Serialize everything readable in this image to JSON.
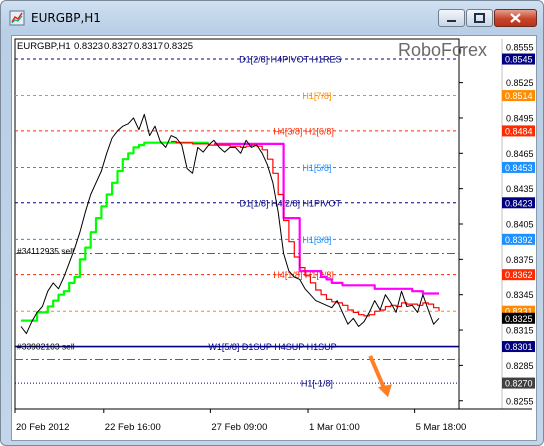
{
  "window": {
    "title": "EURGBP,H1"
  },
  "chart_info": {
    "symbol": "EURGBP,H1",
    "open": "0.8323",
    "high": "0.8327",
    "low": "0.8317",
    "close": "0.8325"
  },
  "watermark": "RoboForex",
  "colors": {
    "price": "#000000",
    "ma_fast": "#ff0000",
    "ma_slow": "#ff00ff",
    "ma_green": "#00ff00",
    "level_navy": "#000080",
    "level_orange": "#ff8c00",
    "level_red": "#ff2a00",
    "level_blue": "#1e90ff",
    "level_green": "#228b22",
    "arrow": "#ff7f27"
  },
  "chart_data": {
    "type": "line",
    "ylim": [
      0.8248,
      0.8562
    ],
    "y_ticks": [
      "0.8555",
      "0.8525",
      "0.8495",
      "0.8465",
      "0.8435",
      "0.8405",
      "0.8375",
      "0.8345",
      "0.8315",
      "0.8285",
      "0.8255"
    ],
    "x_ticks": [
      "20 Feb 2012",
      "22 Feb 16:00",
      "27 Feb 09:00",
      "1 Mar 01:00",
      "5 Mar 18:00"
    ],
    "x_tick_pos": [
      0.0,
      0.2,
      0.44,
      0.66,
      0.9
    ],
    "levels": [
      {
        "name": "D1[2/8] H4PIVOT H1RES",
        "value": 0.8545,
        "color": "navy",
        "style": "dash",
        "label_pos": 0.62
      },
      {
        "name": "H1[7/8]",
        "value": 0.8514,
        "color": "orange",
        "style": "dash",
        "label_pos": 0.68
      },
      {
        "name": "H4[3/8] H1[6/8]",
        "value": 0.8484,
        "color": "red",
        "style": "dash",
        "label_pos": 0.65
      },
      {
        "name": "H1[5/8]",
        "value": 0.8453,
        "color": "blue",
        "style": "dash",
        "label_pos": 0.68
      },
      {
        "name": "D1[1/8] H4[2/8] H1PIVOT",
        "value": 0.8423,
        "color": "navy",
        "style": "dash",
        "label_pos": 0.62
      },
      {
        "name": "H1[3/8]",
        "value": 0.8392,
        "color": "blue",
        "style": "dash",
        "label_pos": 0.68
      },
      {
        "name": "",
        "value": 0.838,
        "color": "green",
        "style": "dashdot",
        "label_pos": 0.0
      },
      {
        "name": "H4[1/8] H1[2/8]",
        "value": 0.8362,
        "color": "red",
        "style": "dash",
        "label_pos": 0.65
      },
      {
        "name": "",
        "value": 0.8331,
        "color": "orange",
        "style": "dash",
        "label_pos": 0.0
      },
      {
        "name": "W1[5/8] D1SUP H4SUP H1SUP",
        "value": 0.8301,
        "color": "navy",
        "style": "solid",
        "label_pos": 0.58
      },
      {
        "name": "",
        "value": 0.829,
        "color": "green",
        "style": "dashdot",
        "label_pos": 0.0
      },
      {
        "name": "H1[-1/8]",
        "value": 0.827,
        "color": "navy",
        "style": "dot",
        "label_pos": 0.68
      }
    ],
    "price_tags": [
      {
        "text": "0.8545",
        "value": 0.8545,
        "color": "#000080"
      },
      {
        "text": "0.8514",
        "value": 0.8514,
        "color": "#ff8c00"
      },
      {
        "text": "0.8484",
        "value": 0.8484,
        "color": "#ff2a00"
      },
      {
        "text": "0.8453",
        "value": 0.8453,
        "color": "#1e90ff"
      },
      {
        "text": "0.8423",
        "value": 0.8423,
        "color": "#000080"
      },
      {
        "text": "0.8392",
        "value": 0.8392,
        "color": "#1e90ff"
      },
      {
        "text": "0.8362",
        "value": 0.8362,
        "color": "#ff2a00"
      },
      {
        "text": "0.8331",
        "value": 0.8331,
        "color": "#ff8c00"
      },
      {
        "text": "0.8325",
        "value": 0.8325,
        "color": "#000000"
      },
      {
        "text": "0.8301",
        "value": 0.8301,
        "color": "#000080"
      },
      {
        "text": "0.8270",
        "value": 0.827,
        "color": "#404040"
      }
    ],
    "orders": [
      {
        "text": "#34112935 sell",
        "value": 0.8382
      },
      {
        "text": "#33982103 sell",
        "value": 0.8301
      }
    ],
    "series": [
      {
        "name": "price",
        "color": "price",
        "values": [
          0.8318,
          0.8312,
          0.8322,
          0.833,
          0.8335,
          0.8348,
          0.8355,
          0.835,
          0.836,
          0.8372,
          0.8384,
          0.8398,
          0.8415,
          0.843,
          0.844,
          0.845,
          0.8465,
          0.8478,
          0.8484,
          0.8488,
          0.849,
          0.8495,
          0.8485,
          0.8498,
          0.848,
          0.8488,
          0.8475,
          0.847,
          0.848,
          0.8478,
          0.8472,
          0.8452,
          0.8448,
          0.847,
          0.8466,
          0.8472,
          0.8476,
          0.847,
          0.8466,
          0.847,
          0.847,
          0.8465,
          0.8476,
          0.847,
          0.8472,
          0.8465,
          0.8455,
          0.844,
          0.8415,
          0.838,
          0.8365,
          0.836,
          0.8358,
          0.835,
          0.8345,
          0.834,
          0.8338,
          0.8336,
          0.8334,
          0.834,
          0.833,
          0.832,
          0.8325,
          0.8318,
          0.8322,
          0.833,
          0.834,
          0.8332,
          0.8345,
          0.8338,
          0.833,
          0.8348,
          0.8335,
          0.8336,
          0.833,
          0.8345,
          0.8332,
          0.832,
          0.8325
        ]
      },
      {
        "name": "ma_fast",
        "color": "ma_fast",
        "values": [
          null,
          null,
          null,
          null,
          null,
          null,
          null,
          null,
          null,
          null,
          null,
          null,
          null,
          null,
          null,
          null,
          null,
          null,
          null,
          null,
          null,
          null,
          null,
          null,
          null,
          null,
          null,
          null,
          0.8475,
          0.8474,
          0.8474,
          0.8474,
          0.8473,
          0.8473,
          0.8473,
          0.8472,
          0.8472,
          0.8472,
          0.8472,
          0.8471,
          0.8471,
          0.847,
          0.8471,
          0.8472,
          0.8471,
          0.8468,
          0.846,
          0.8448,
          0.843,
          0.8408,
          0.839,
          0.8377,
          0.8368,
          0.8361,
          0.8355,
          0.8349,
          0.8345,
          0.8341,
          0.8339,
          0.8338,
          0.8336,
          0.8332,
          0.833,
          0.8328,
          0.8327,
          0.8328,
          0.8331,
          0.8332,
          0.8335,
          0.8336,
          0.8335,
          0.8338,
          0.8337,
          0.8337,
          0.8336,
          0.8338,
          0.8337,
          0.8334,
          0.8331
        ]
      },
      {
        "name": "ma_slow",
        "color": "ma_slow",
        "values": [
          null,
          null,
          null,
          null,
          null,
          null,
          null,
          null,
          null,
          null,
          null,
          null,
          null,
          null,
          null,
          null,
          null,
          null,
          null,
          null,
          null,
          null,
          null,
          null,
          null,
          null,
          null,
          null,
          null,
          null,
          null,
          null,
          null,
          null,
          null,
          null,
          0.8473,
          0.8473,
          0.8473,
          0.8473,
          0.8473,
          0.8473,
          0.8473,
          0.8473,
          0.8473,
          0.8473,
          0.8473,
          0.8473,
          0.8473,
          0.841,
          0.841,
          0.841,
          0.8365,
          0.8365,
          0.8365,
          0.8365,
          0.836,
          0.8358,
          0.8355,
          0.8355,
          0.8353,
          0.8353,
          0.8353,
          0.8353,
          0.8353,
          0.8353,
          0.835,
          0.835,
          0.835,
          0.835,
          0.835,
          0.835,
          0.835,
          0.8348,
          0.8348,
          0.8346,
          0.8346,
          0.8346,
          0.8346
        ]
      },
      {
        "name": "ma_green",
        "color": "ma_green",
        "values": [
          0.8323,
          0.8323,
          0.8323,
          0.833,
          0.833,
          0.8335,
          0.834,
          0.8345,
          0.8348,
          0.8355,
          0.836,
          0.8375,
          0.8385,
          0.8398,
          0.841,
          0.842,
          0.843,
          0.844,
          0.845,
          0.846,
          0.8465,
          0.847,
          0.8472,
          0.8474,
          0.8474,
          0.8474,
          0.8474,
          0.8474,
          0.8474,
          0.8474,
          0.8474,
          0.8474,
          0.8474,
          0.8474,
          0.8474,
          0.8474,
          null,
          null,
          null,
          null,
          null,
          null,
          null,
          null,
          null,
          null,
          null,
          null,
          null,
          null,
          null,
          null,
          null,
          null,
          null,
          null,
          null,
          null,
          null,
          null,
          null,
          null,
          null,
          null,
          null,
          null,
          null,
          null,
          null,
          null,
          null,
          null,
          null,
          null,
          null,
          null,
          null,
          null,
          null
        ]
      }
    ],
    "arrow": {
      "from": [
        0.8,
        0.8293
      ],
      "to": [
        0.84,
        0.8258
      ]
    }
  }
}
